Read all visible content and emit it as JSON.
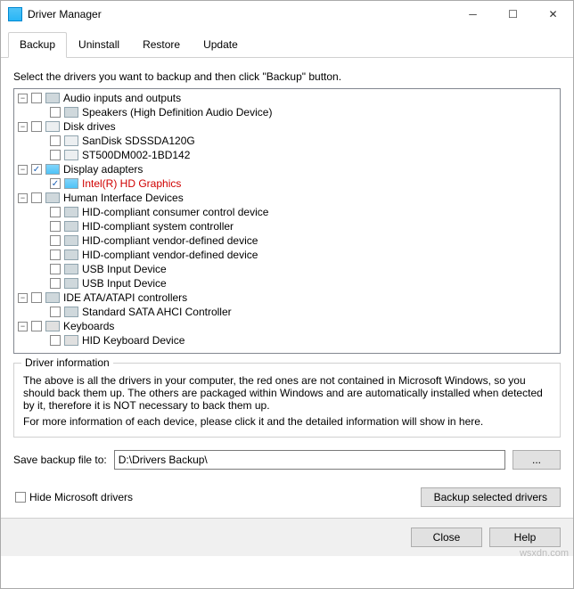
{
  "window": {
    "title": "Driver Manager"
  },
  "tabs": {
    "backup": "Backup",
    "uninstall": "Uninstall",
    "restore": "Restore",
    "update": "Update"
  },
  "instruction": "Select the drivers you want to backup and then click \"Backup\" button.",
  "tree": {
    "audio": {
      "label": "Audio inputs and outputs",
      "c0": "Speakers (High Definition Audio Device)"
    },
    "disk": {
      "label": "Disk drives",
      "c0": "SanDisk SDSSDA120G",
      "c1": "ST500DM002-1BD142"
    },
    "display": {
      "label": "Display adapters",
      "c0": "Intel(R) HD Graphics"
    },
    "hid": {
      "label": "Human Interface Devices",
      "c0": "HID-compliant consumer control device",
      "c1": "HID-compliant system controller",
      "c2": "HID-compliant vendor-defined device",
      "c3": "HID-compliant vendor-defined device",
      "c4": "USB Input Device",
      "c5": "USB Input Device"
    },
    "ide": {
      "label": "IDE ATA/ATAPI controllers",
      "c0": "Standard SATA AHCI Controller"
    },
    "kb": {
      "label": "Keyboards",
      "c0": "HID Keyboard Device"
    }
  },
  "info": {
    "legend": "Driver information",
    "para1": "The above is all the drivers in your computer, the red ones are not contained in Microsoft Windows, so you should back them up. The others are packaged within Windows and are automatically installed when detected by it, therefore it is NOT necessary to back them up.",
    "para2": "For more information of each device, please click it and the detailed information will show in here."
  },
  "save": {
    "label": "Save backup file to:",
    "path": "D:\\Drivers Backup\\",
    "browse": "..."
  },
  "hide": "Hide Microsoft drivers",
  "action": "Backup selected drivers",
  "footer": {
    "close": "Close",
    "help": "Help"
  },
  "watermark": "wsxdn.com"
}
